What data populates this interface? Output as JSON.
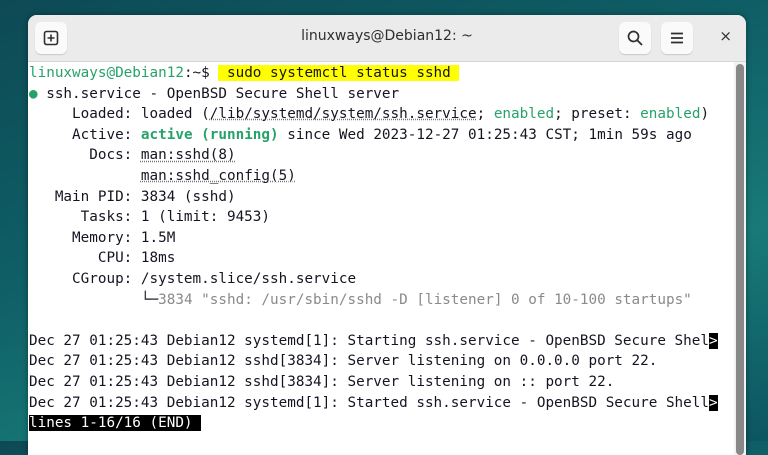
{
  "window": {
    "title": "linuxways@Debian12: ~"
  },
  "icons": {
    "new_tab": "new-tab-icon",
    "search": "search-icon",
    "menu": "hamburger-menu-icon",
    "close": "close-icon"
  },
  "close_glyph": "×",
  "terminal": {
    "lines": [
      [
        {
          "t": "linuxways@Debian12",
          "c": "g"
        },
        {
          "t": ":~$ ",
          "c": ""
        },
        {
          "t": " sudo systemctl status sshd ",
          "c": "hl"
        }
      ],
      [
        {
          "t": "●",
          "c": "g"
        },
        {
          "t": " ssh.service - OpenBSD Secure Shell server",
          "c": ""
        }
      ],
      [
        {
          "t": "     Loaded: loaded (",
          "c": ""
        },
        {
          "t": "/lib/systemd/system/ssh.service",
          "c": "ul"
        },
        {
          "t": "; ",
          "c": ""
        },
        {
          "t": "enabled",
          "c": "g"
        },
        {
          "t": "; preset: ",
          "c": ""
        },
        {
          "t": "enabled",
          "c": "g"
        },
        {
          "t": ")",
          "c": ""
        }
      ],
      [
        {
          "t": "     Active: ",
          "c": ""
        },
        {
          "t": "active (running)",
          "c": "gb"
        },
        {
          "t": " since Wed 2023-12-27 01:25:43 CST; 1min 59s ago",
          "c": ""
        }
      ],
      [
        {
          "t": "       Docs: ",
          "c": ""
        },
        {
          "t": "man:sshd(8)",
          "c": "ul"
        }
      ],
      [
        {
          "t": "             ",
          "c": ""
        },
        {
          "t": "man:sshd_config(5)",
          "c": "ul"
        }
      ],
      [
        {
          "t": "   Main PID: 3834 (sshd)",
          "c": ""
        }
      ],
      [
        {
          "t": "      Tasks: 1 (limit: 9453)",
          "c": ""
        }
      ],
      [
        {
          "t": "     Memory: 1.5M",
          "c": ""
        }
      ],
      [
        {
          "t": "        CPU: 18ms",
          "c": ""
        }
      ],
      [
        {
          "t": "     CGroup: /system.slice/ssh.service",
          "c": ""
        }
      ],
      [
        {
          "t": "             └─",
          "c": ""
        },
        {
          "t": "3834 \"sshd: /usr/sbin/sshd -D [listener] 0 of 10-100 startups\"",
          "c": "gray"
        }
      ],
      [
        {
          "t": "",
          "c": ""
        }
      ],
      [
        {
          "t": "Dec 27 01:25:43 Debian12 systemd[1]: Starting ssh.service - OpenBSD Secure Shel",
          "c": ""
        },
        {
          "t": ">",
          "c": "inv"
        }
      ],
      [
        {
          "t": "Dec 27 01:25:43 Debian12 sshd[3834]: Server listening on 0.0.0.0 port 22.",
          "c": ""
        }
      ],
      [
        {
          "t": "Dec 27 01:25:43 Debian12 sshd[3834]: Server listening on :: port 22.",
          "c": ""
        }
      ],
      [
        {
          "t": "Dec 27 01:25:43 Debian12 systemd[1]: Started ssh.service - OpenBSD Secure Shell",
          "c": ""
        },
        {
          "t": ">",
          "c": "inv"
        }
      ],
      [
        {
          "t": "lines 1-16/16 (END)",
          "c": "inv"
        },
        {
          "t": " ",
          "c": "inv"
        }
      ]
    ]
  }
}
